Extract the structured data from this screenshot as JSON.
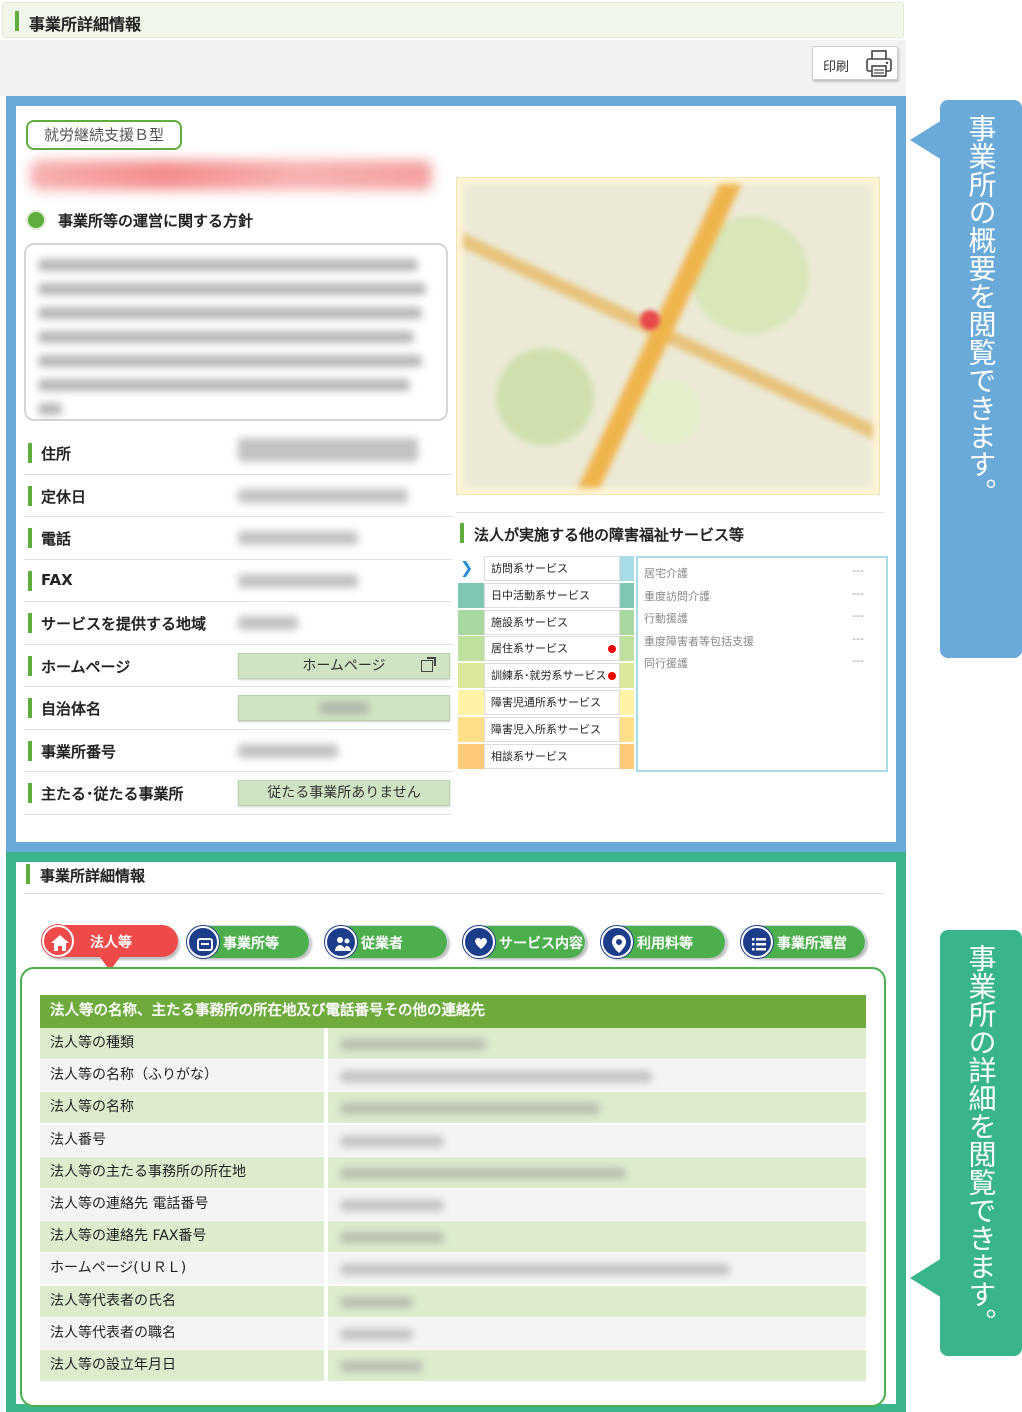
{
  "header": {
    "title": "事業所詳細情報"
  },
  "print": {
    "label": "印刷",
    "icon": "printer-icon"
  },
  "overview": {
    "service_type": "就労継続支援Ｂ型",
    "policy_heading": "事業所等の運営に関する方針",
    "rows": [
      {
        "label": "住所",
        "kind": "blur"
      },
      {
        "label": "定休日",
        "kind": "blur"
      },
      {
        "label": "電話",
        "kind": "blur"
      },
      {
        "label": "FAX",
        "kind": "blur"
      },
      {
        "label": "サービスを提供する地域",
        "kind": "blur"
      },
      {
        "label": "ホームページ",
        "kind": "button",
        "button": "ホームページ"
      },
      {
        "label": "自治体名",
        "kind": "blurbtn"
      },
      {
        "label": "事業所番号",
        "kind": "blur"
      },
      {
        "label": "主たる･従たる事業所",
        "kind": "button",
        "button": "従たる事業所ありません"
      }
    ],
    "other_services_heading": "法人が実施する他の障害福祉サービス等",
    "service_categories": [
      {
        "label": "訪問系サービス",
        "color": "#a7dbe6",
        "selected": true,
        "dot": false
      },
      {
        "label": "日中活動系サービス",
        "color": "#7fc7b3",
        "selected": false,
        "dot": false
      },
      {
        "label": "施設系サービス",
        "color": "#a9d9a0",
        "selected": false,
        "dot": false
      },
      {
        "label": "居住系サービス",
        "color": "#bfe09e",
        "selected": false,
        "dot": true
      },
      {
        "label": "訓練系･就労系サービス",
        "color": "#dbe89a",
        "selected": false,
        "dot": true
      },
      {
        "label": "障害児通所系サービス",
        "color": "#fff3a6",
        "selected": false,
        "dot": false
      },
      {
        "label": "障害児入所系サービス",
        "color": "#ffe08a",
        "selected": false,
        "dot": false
      },
      {
        "label": "相談系サービス",
        "color": "#ffc97a",
        "selected": false,
        "dot": false
      }
    ],
    "service_details": [
      {
        "name": "居宅介護",
        "value": "---"
      },
      {
        "name": "重度訪問介護",
        "value": "---"
      },
      {
        "name": "行動援護",
        "value": "---"
      },
      {
        "name": "重度障害者等包括支援",
        "value": "---"
      },
      {
        "name": "同行援護",
        "value": "---"
      }
    ]
  },
  "details": {
    "title": "事業所詳細情報",
    "tabs": [
      {
        "label": "法人等",
        "icon": "home-icon",
        "active": true
      },
      {
        "label": "事業所等",
        "icon": "building-icon",
        "active": false
      },
      {
        "label": "従業者",
        "icon": "people-icon",
        "active": false
      },
      {
        "label": "サービス内容",
        "icon": "heart-hand-icon",
        "active": false
      },
      {
        "label": "利用料等",
        "icon": "map-pin-icon",
        "active": false
      },
      {
        "label": "事業所運営",
        "icon": "list-icon",
        "active": false
      }
    ],
    "table_heading": "法人等の名称、主たる事務所の所在地及び電話番号その他の連絡先",
    "rows": [
      {
        "key": "法人等の種類",
        "blur": 0.28
      },
      {
        "key": "法人等の名称（ふりがな）",
        "blur": 0.6
      },
      {
        "key": "法人等の名称",
        "blur": 0.5
      },
      {
        "key": "法人番号",
        "blur": 0.2
      },
      {
        "key": "法人等の主たる事務所の所在地",
        "blur": 0.55
      },
      {
        "key": "法人等の連絡先 電話番号",
        "blur": 0.2
      },
      {
        "key": "法人等の連絡先 FAX番号",
        "blur": 0.2
      },
      {
        "key": "ホームページ(ＵＲＬ)",
        "blur": 0.75
      },
      {
        "key": "法人等代表者の氏名",
        "blur": 0.14
      },
      {
        "key": "法人等代表者の職名",
        "blur": 0.14
      },
      {
        "key": "法人等の設立年月日",
        "blur": 0.16
      }
    ]
  },
  "callouts": {
    "overview": "事業所の概要を閲覧できます。",
    "details": "事業所の詳細を閲覧できます。"
  },
  "colors": {
    "accent_green": "#5fad3c",
    "frame_blue": "#6aaad8",
    "frame_teal": "#39b58a",
    "active_tab": "#ef4a4a",
    "tab_green": "#4cae4c"
  }
}
